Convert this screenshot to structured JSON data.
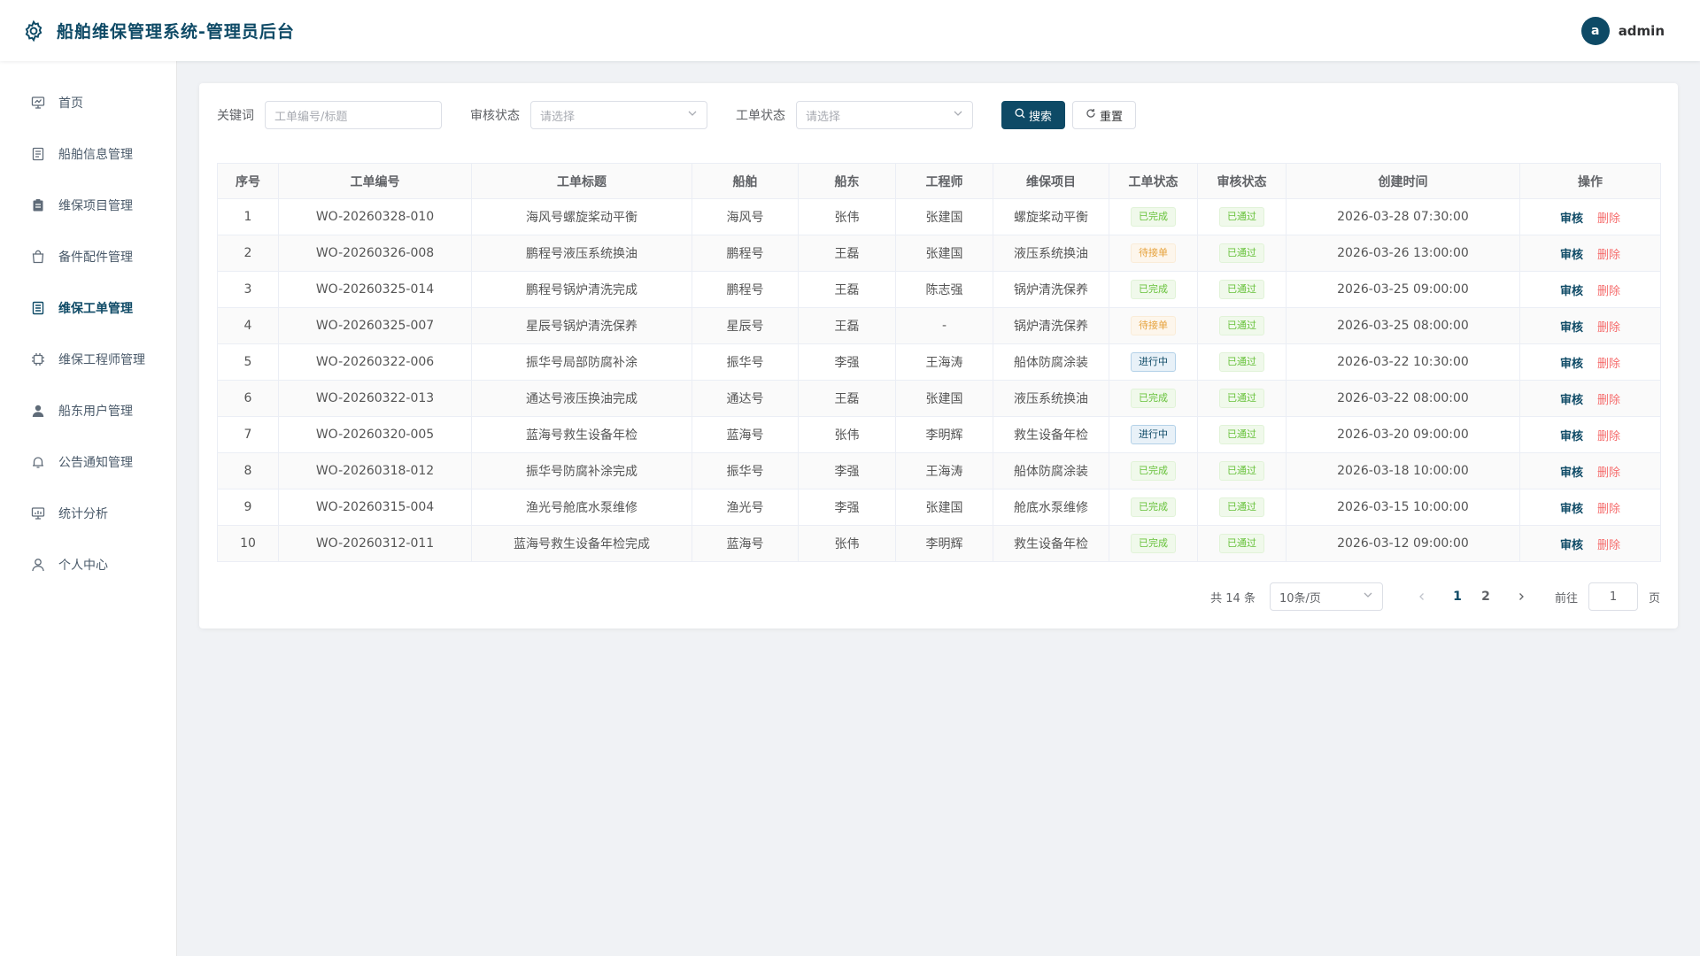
{
  "header": {
    "title": "船舶维保管理系统-管理员后台",
    "avatar_letter": "a",
    "username": "admin"
  },
  "sidebar": {
    "items": [
      {
        "label": "首页",
        "icon": "monitor-icon"
      },
      {
        "label": "船舶信息管理",
        "icon": "document-icon"
      },
      {
        "label": "维保项目管理",
        "icon": "clipboard-icon"
      },
      {
        "label": "备件配件管理",
        "icon": "shopping-bag-icon"
      },
      {
        "label": "维保工单管理",
        "icon": "tickets-icon",
        "active": true
      },
      {
        "label": "维保工程师管理",
        "icon": "cpu-icon"
      },
      {
        "label": "船东用户管理",
        "icon": "user-filled-icon"
      },
      {
        "label": "公告通知管理",
        "icon": "bell-icon"
      },
      {
        "label": "统计分析",
        "icon": "chart-icon"
      },
      {
        "label": "个人中心",
        "icon": "user-icon"
      }
    ]
  },
  "filters": {
    "keyword_label": "关键词",
    "keyword_placeholder": "工单编号/标题",
    "audit_label": "审核状态",
    "audit_placeholder": "请选择",
    "status_label": "工单状态",
    "status_placeholder": "请选择",
    "search_label": "搜索",
    "reset_label": "重置"
  },
  "table": {
    "headers": [
      "序号",
      "工单编号",
      "工单标题",
      "船舶",
      "船东",
      "工程师",
      "维保项目",
      "工单状态",
      "审核状态",
      "创建时间",
      "操作"
    ],
    "audit_action": "审核",
    "delete_action": "删除",
    "rows": [
      {
        "no": "1",
        "code": "WO-20260328-010",
        "title": "海风号螺旋桨动平衡",
        "ship": "海风号",
        "owner": "张伟",
        "engineer": "张建国",
        "project": "螺旋桨动平衡",
        "status": "已完成",
        "status_color": "green",
        "audit": "已通过",
        "created": "2026-03-28 07:30:00"
      },
      {
        "no": "2",
        "code": "WO-20260326-008",
        "title": "鹏程号液压系统换油",
        "ship": "鹏程号",
        "owner": "王磊",
        "engineer": "张建国",
        "project": "液压系统换油",
        "status": "待接单",
        "status_color": "orange",
        "audit": "已通过",
        "created": "2026-03-26 13:00:00"
      },
      {
        "no": "3",
        "code": "WO-20260325-014",
        "title": "鹏程号锅炉清洗完成",
        "ship": "鹏程号",
        "owner": "王磊",
        "engineer": "陈志强",
        "project": "锅炉清洗保养",
        "status": "已完成",
        "status_color": "green",
        "audit": "已通过",
        "created": "2026-03-25 09:00:00"
      },
      {
        "no": "4",
        "code": "WO-20260325-007",
        "title": "星辰号锅炉清洗保养",
        "ship": "星辰号",
        "owner": "王磊",
        "engineer": "-",
        "project": "锅炉清洗保养",
        "status": "待接单",
        "status_color": "orange",
        "audit": "已通过",
        "created": "2026-03-25 08:00:00"
      },
      {
        "no": "5",
        "code": "WO-20260322-006",
        "title": "振华号局部防腐补涂",
        "ship": "振华号",
        "owner": "李强",
        "engineer": "王海涛",
        "project": "船体防腐涂装",
        "status": "进行中",
        "status_color": "blue",
        "audit": "已通过",
        "created": "2026-03-22 10:30:00"
      },
      {
        "no": "6",
        "code": "WO-20260322-013",
        "title": "通达号液压换油完成",
        "ship": "通达号",
        "owner": "王磊",
        "engineer": "张建国",
        "project": "液压系统换油",
        "status": "已完成",
        "status_color": "green",
        "audit": "已通过",
        "created": "2026-03-22 08:00:00"
      },
      {
        "no": "7",
        "code": "WO-20260320-005",
        "title": "蓝海号救生设备年检",
        "ship": "蓝海号",
        "owner": "张伟",
        "engineer": "李明辉",
        "project": "救生设备年检",
        "status": "进行中",
        "status_color": "blue",
        "audit": "已通过",
        "created": "2026-03-20 09:00:00"
      },
      {
        "no": "8",
        "code": "WO-20260318-012",
        "title": "振华号防腐补涂完成",
        "ship": "振华号",
        "owner": "李强",
        "engineer": "王海涛",
        "project": "船体防腐涂装",
        "status": "已完成",
        "status_color": "green",
        "audit": "已通过",
        "created": "2026-03-18 10:00:00"
      },
      {
        "no": "9",
        "code": "WO-20260315-004",
        "title": "渔光号舱底水泵维修",
        "ship": "渔光号",
        "owner": "李强",
        "engineer": "张建国",
        "project": "舱底水泵维修",
        "status": "已完成",
        "status_color": "green",
        "audit": "已通过",
        "created": "2026-03-15 10:00:00"
      },
      {
        "no": "10",
        "code": "WO-20260312-011",
        "title": "蓝海号救生设备年检完成",
        "ship": "蓝海号",
        "owner": "张伟",
        "engineer": "李明辉",
        "project": "救生设备年检",
        "status": "已完成",
        "status_color": "green",
        "audit": "已通过",
        "created": "2026-03-12 09:00:00"
      }
    ]
  },
  "pagination": {
    "total_text": "共 14 条",
    "page_size": "10条/页",
    "pages": [
      "1",
      "2"
    ],
    "current": "1",
    "goto_label": "前往",
    "goto_value": "1",
    "page_suffix": "页"
  },
  "colors": {
    "primary": "#0e4a66",
    "success": "#67c23a",
    "warning": "#e6a23c",
    "danger": "#f56c6c"
  }
}
